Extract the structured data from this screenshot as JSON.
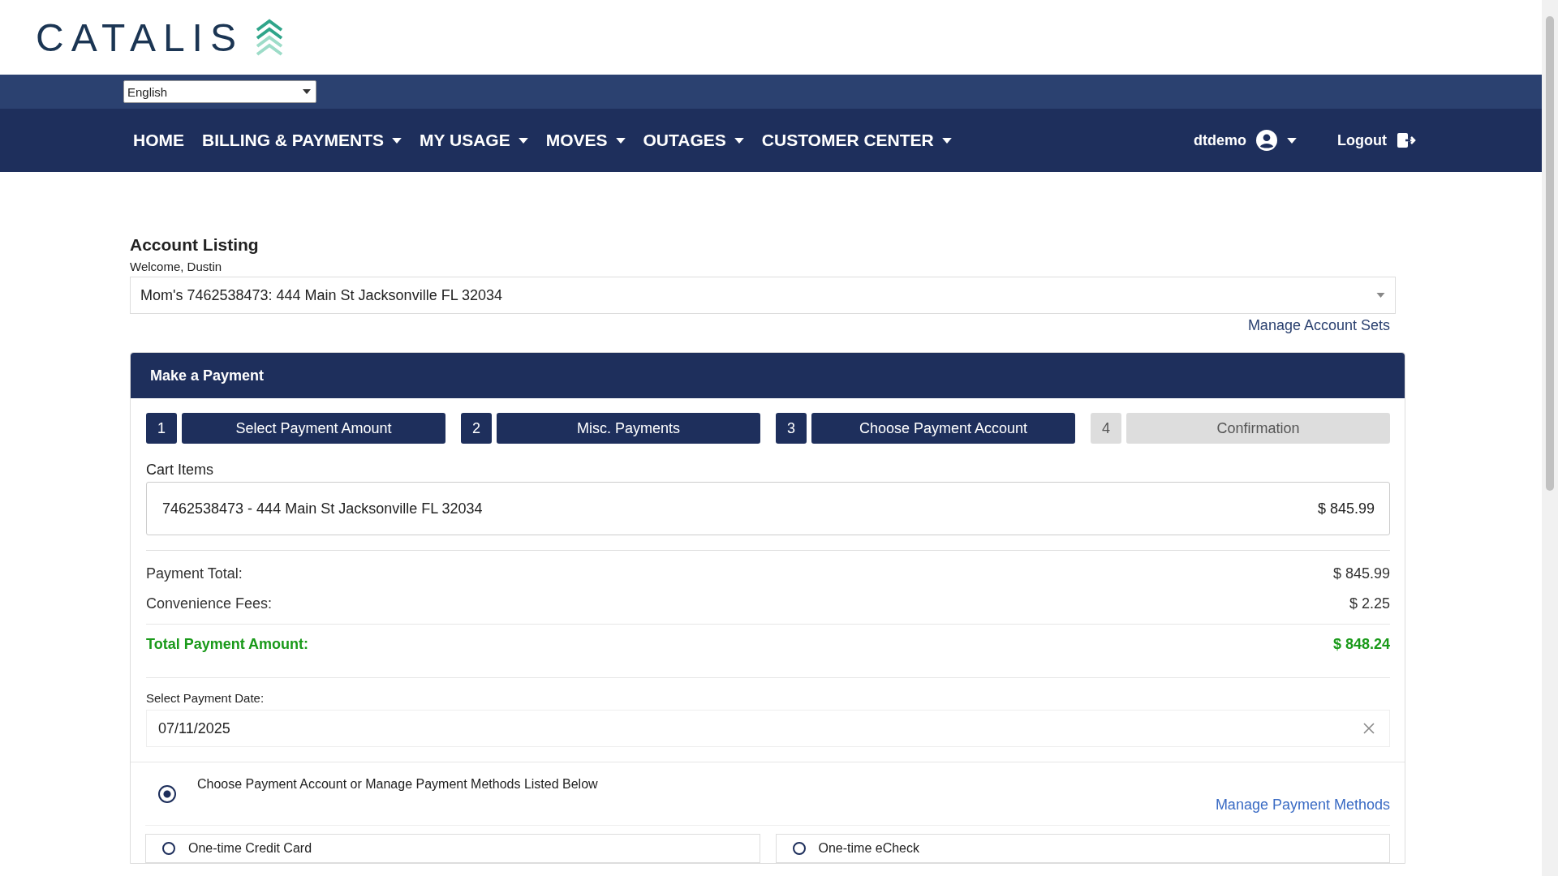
{
  "header": {
    "logo": "CATALIS"
  },
  "language": {
    "value": "English"
  },
  "nav": {
    "items": [
      {
        "label": "HOME",
        "dropdown": false
      },
      {
        "label": "BILLING & PAYMENTS",
        "dropdown": true
      },
      {
        "label": "MY USAGE",
        "dropdown": true
      },
      {
        "label": "MOVES",
        "dropdown": true
      },
      {
        "label": "OUTAGES",
        "dropdown": true
      },
      {
        "label": "CUSTOMER CENTER",
        "dropdown": true
      }
    ],
    "user": "dtdemo",
    "logout": "Logout"
  },
  "account": {
    "title": "Account Listing",
    "welcome": "Welcome, Dustin",
    "selected_account": "Mom's 7462538473: 444 Main St Jacksonville FL 32034",
    "manage_link": "Manage Account Sets"
  },
  "payment": {
    "title": "Make a Payment",
    "steps": [
      {
        "number": "1",
        "label": "Select Payment Amount",
        "done": true
      },
      {
        "number": "2",
        "label": "Misc. Payments",
        "done": true
      },
      {
        "number": "3",
        "label": "Choose Payment Account",
        "done": true
      },
      {
        "number": "4",
        "label": "Confirmation",
        "done": false
      }
    ],
    "cart_label": "Cart Items",
    "cart_items": [
      {
        "description": "7462538473 - 444 Main St Jacksonville FL 32034",
        "amount": "$ 845.99"
      }
    ],
    "summary": [
      {
        "label": "Payment Total:",
        "value": "$ 845.99",
        "kind": "normal"
      },
      {
        "label": "Convenience Fees:",
        "value": "$ 2.25",
        "kind": "normal"
      },
      {
        "label": "Total Payment Amount:",
        "value": "$ 848.24",
        "kind": "total"
      }
    ],
    "date_label": "Select Payment Date:",
    "date_value": "07/11/2025",
    "main_option": {
      "label": "Choose Payment Account or Manage Payment Methods Listed Below",
      "selected": true,
      "link": "Manage Payment Methods"
    },
    "one_time_options": [
      {
        "label": "One-time Credit Card",
        "selected": false
      },
      {
        "label": "One-time eCheck",
        "selected": false
      }
    ]
  }
}
